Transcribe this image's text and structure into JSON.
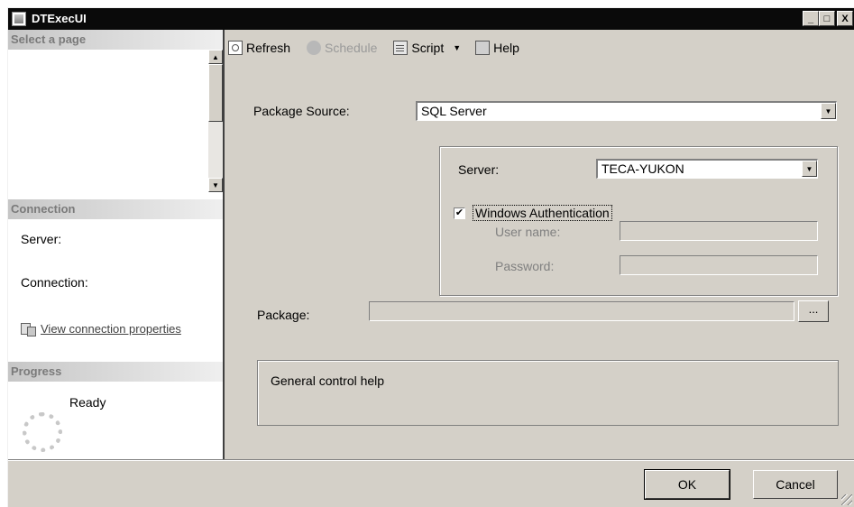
{
  "window": {
    "title": "DTExecUI",
    "controls": [
      "_",
      "□",
      "X"
    ]
  },
  "left_pane": {
    "select_page_header": "Select a page",
    "connection_header": "Connection",
    "server_label": "Server:",
    "connection_label": "Connection:",
    "view_connection_link": "View connection properties",
    "progress_header": "Progress",
    "progress_status": "Ready"
  },
  "toolbar": {
    "refresh": "Refresh",
    "schedule": "Schedule",
    "script": "Script",
    "dropdown_caret": "▼",
    "help": "Help"
  },
  "form": {
    "package_source_label": "Package Source:",
    "package_source_value": "SQL Server",
    "server_label": "Server:",
    "server_value": "TECA-YUKON",
    "windows_auth_label": "Windows Authentication",
    "windows_auth_checked": true,
    "check_mark": "✔",
    "user_name_label": "User name:",
    "user_name_value": "",
    "password_label": "Password:",
    "password_value": "",
    "package_label": "Package:",
    "package_value": "",
    "browse_button": "...",
    "help_text": "General control help"
  },
  "buttons": {
    "ok": "OK",
    "cancel": "Cancel"
  },
  "icons": {
    "combo_arrow": "▼",
    "scroll_up": "▲",
    "scroll_down": "▼"
  }
}
